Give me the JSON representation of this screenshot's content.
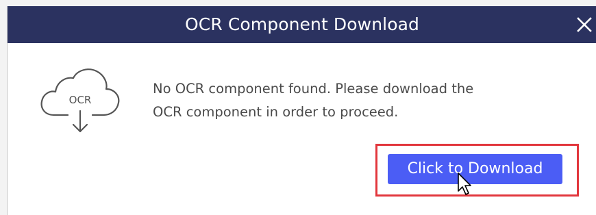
{
  "dialog": {
    "title": "OCR Component Download",
    "close_glyph": "✕",
    "icon_label": "OCR",
    "message_line1": "No OCR component found. Please download the",
    "message_line2": "OCR component in order to proceed.",
    "download_label": "Click to Download"
  },
  "colors": {
    "titlebar": "#2b3260",
    "button": "#4b5df5",
    "highlight": "#e2363c",
    "text": "#4a4a4a"
  },
  "icons": {
    "cloud": "cloud-download-icon",
    "close": "close-icon",
    "cursor": "mouse-pointer-icon"
  }
}
